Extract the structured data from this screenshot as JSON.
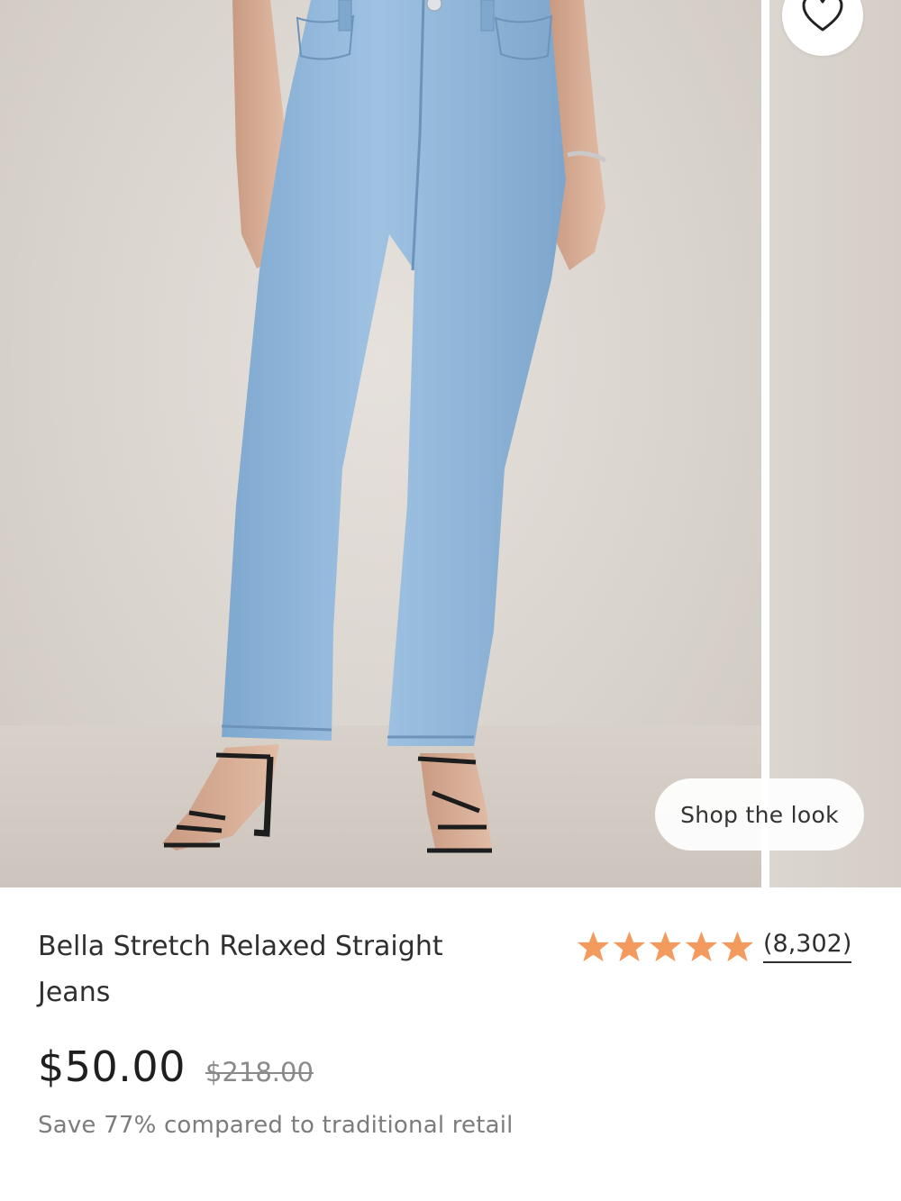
{
  "product": {
    "title": "Bella Stretch Relaxed Straight Jeans",
    "price": "$50.00",
    "original_price": "$218.00",
    "savings_text": "Save 77% compared to traditional retail",
    "rating": {
      "stars": 5,
      "review_count": "(8,302)"
    }
  },
  "gallery": {
    "shop_the_look_label": "Shop the look",
    "wishlist_icon": "heart-icon"
  },
  "colors": {
    "star": "#F39A5E",
    "denim": "#8FB6DA",
    "photo_background": "#DCD6D0"
  }
}
